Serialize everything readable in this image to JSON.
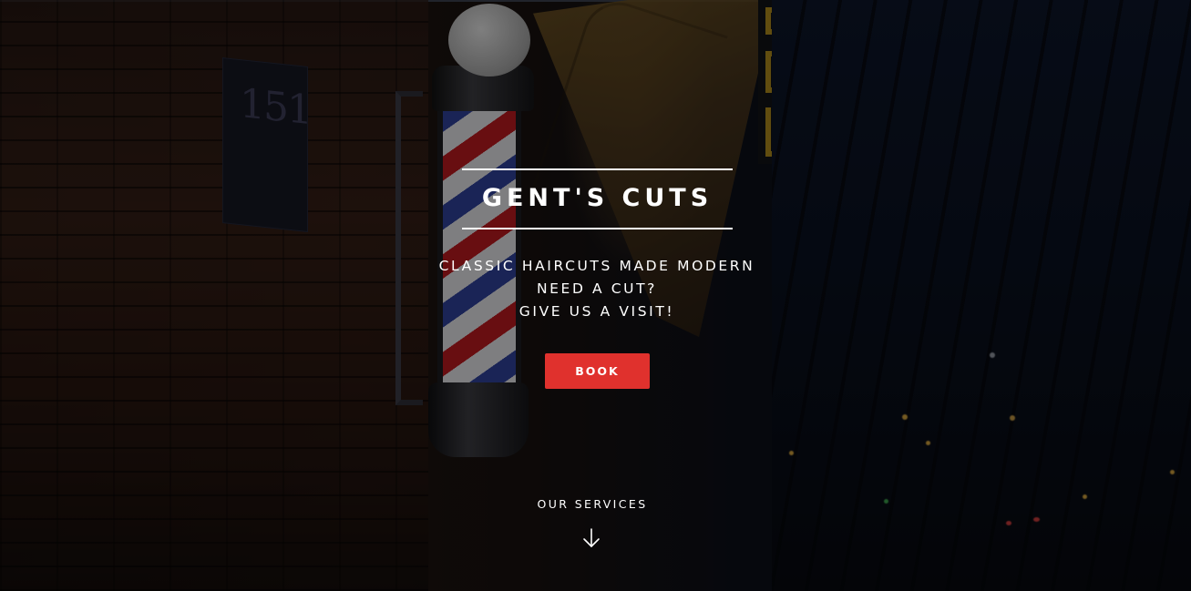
{
  "hero": {
    "title": "GENT'S CUTS",
    "taglines": [
      "CLASSIC HAIRCUTS MADE MODERN",
      "NEED A CUT?",
      "GIVE US A VISIT!"
    ],
    "book_label": "BOOK",
    "services_label": "OUR SERVICES",
    "services_icon": "arrow-down-icon",
    "background_icon": "barber-pole-photo"
  },
  "colors": {
    "accent": "#e0312d",
    "text": "#ffffff",
    "overlay": "#000000"
  }
}
